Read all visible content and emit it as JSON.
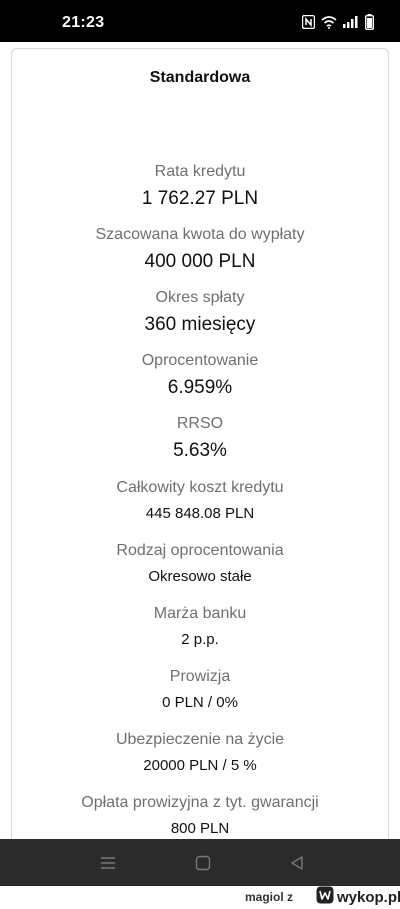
{
  "status_bar": {
    "time": "21:23",
    "icons": [
      "nfc-icon",
      "wifi-icon",
      "signal-icon",
      "battery-icon"
    ]
  },
  "card": {
    "title": "Standardowa",
    "items": [
      {
        "label": "Rata kredytu",
        "value": "1 762.27 PLN"
      },
      {
        "label": "Szacowana kwota do wypłaty",
        "value": "400 000 PLN"
      },
      {
        "label": "Okres spłaty",
        "value": "360 miesięcy"
      },
      {
        "label": "Oprocentowanie",
        "value": "6.959%"
      },
      {
        "label": "RRSO",
        "value": "5.63%"
      },
      {
        "label": "Całkowity koszt kredytu",
        "value": "445 848.08 PLN"
      },
      {
        "label": "Rodzaj oprocentowania",
        "value": "Okresowo stałe"
      },
      {
        "label": "Marża banku",
        "value": "2 p.p."
      },
      {
        "label": "Prowizja",
        "value": "0 PLN / 0%"
      },
      {
        "label": "Ubezpieczenie na życie",
        "value": "20000 PLN / 5 %"
      },
      {
        "label": "Opłata prowizyjna z tyt. gwarancji",
        "value": "800 PLN"
      }
    ]
  },
  "nav_bar": {
    "buttons": [
      "menu-icon",
      "home-icon",
      "back-icon"
    ],
    "color": "#2b2b2b"
  },
  "watermark": {
    "user": "magiol z",
    "site": "wykop.pl"
  }
}
